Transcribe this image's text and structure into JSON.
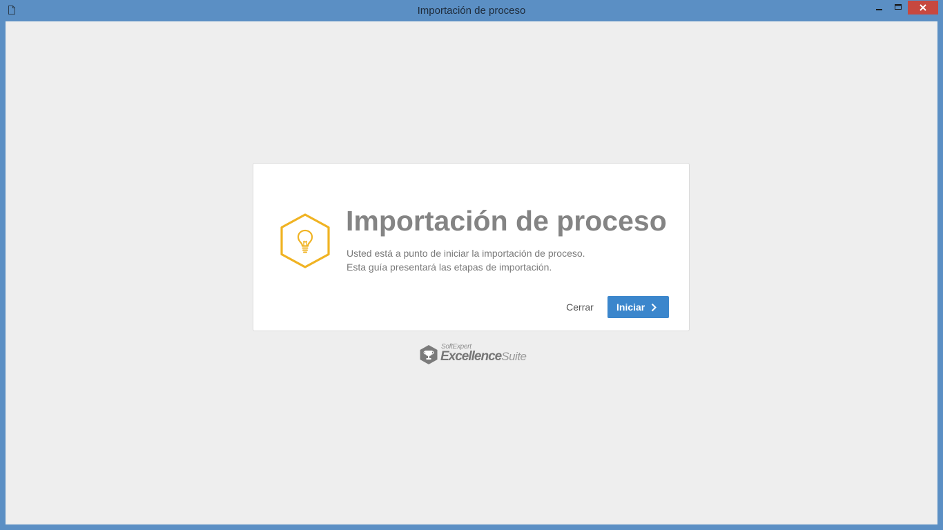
{
  "window": {
    "title": "Importación de proceso",
    "frame_color": "#5b8fc4",
    "close_color": "#c7483f"
  },
  "titlebar_icons": {
    "app": "document-icon",
    "minimize": "minimize-icon",
    "maximize": "maximize-icon",
    "close": "close-icon"
  },
  "card": {
    "icon": "lightbulb-hexagon-icon",
    "icon_color": "#f0b323",
    "title": "Importación de proceso",
    "description_lines": [
      "Usted está a punto de iniciar la importación de proceso.",
      "Esta guía presentará las etapas de importación."
    ],
    "close_label": "Cerrar",
    "start_label": "Iniciar",
    "start_color": "#3b86cc"
  },
  "footer_logo": {
    "small_text": "SoftExpert",
    "big_text_bold": "Excellence",
    "big_text_light": "Suite"
  }
}
